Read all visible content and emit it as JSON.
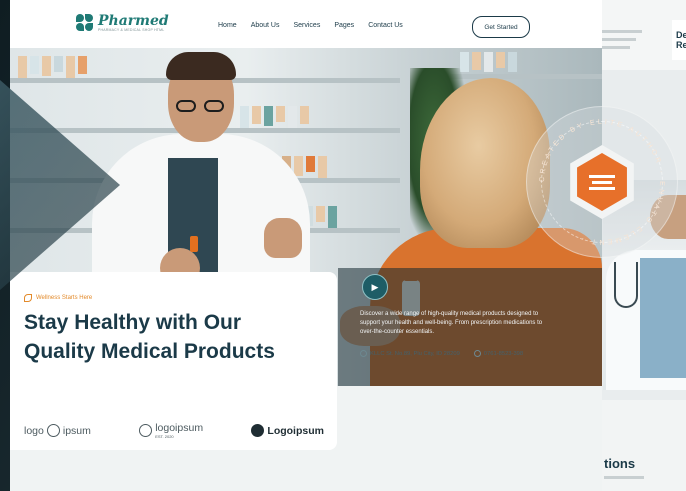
{
  "brand": {
    "name": "Pharmed",
    "tagline": "PHARMACY & MEDICAL SHOP HTML"
  },
  "nav": {
    "items": [
      "Home",
      "About Us",
      "Services",
      "Pages",
      "Contact Us"
    ],
    "cta_label": "Get Started"
  },
  "hero": {
    "eyebrow": "Wellness Starts Here",
    "headline_line1": "Stay Healthy with Our",
    "headline_line2": "Quality Medical Products",
    "description": "Discover a wide range of high-quality medical products designed to support your health and well-being. From prescription medications to over-the-counter essentials.",
    "play_icon": "play-icon"
  },
  "contact": {
    "address": "KLLC St. No.89, Plu City, ID 28209",
    "phone": "0761-8523-398"
  },
  "partners": [
    {
      "label": "logo",
      "suffix": "ipsum"
    },
    {
      "label": "logoipsum",
      "sub": "EST. 2020"
    },
    {
      "label": "Logoipsum"
    }
  ],
  "badge": {
    "ring_text": "CREATED BY ELITE AUTHOR · ENVATO ELEMENT · "
  },
  "side_panel": {
    "card_title_line1": "De",
    "card_title_line2": "Re",
    "lower_heading": "tions"
  },
  "colors": {
    "primary": "#1b3a48",
    "accent": "#1f7a75",
    "orange": "#e7702a"
  }
}
